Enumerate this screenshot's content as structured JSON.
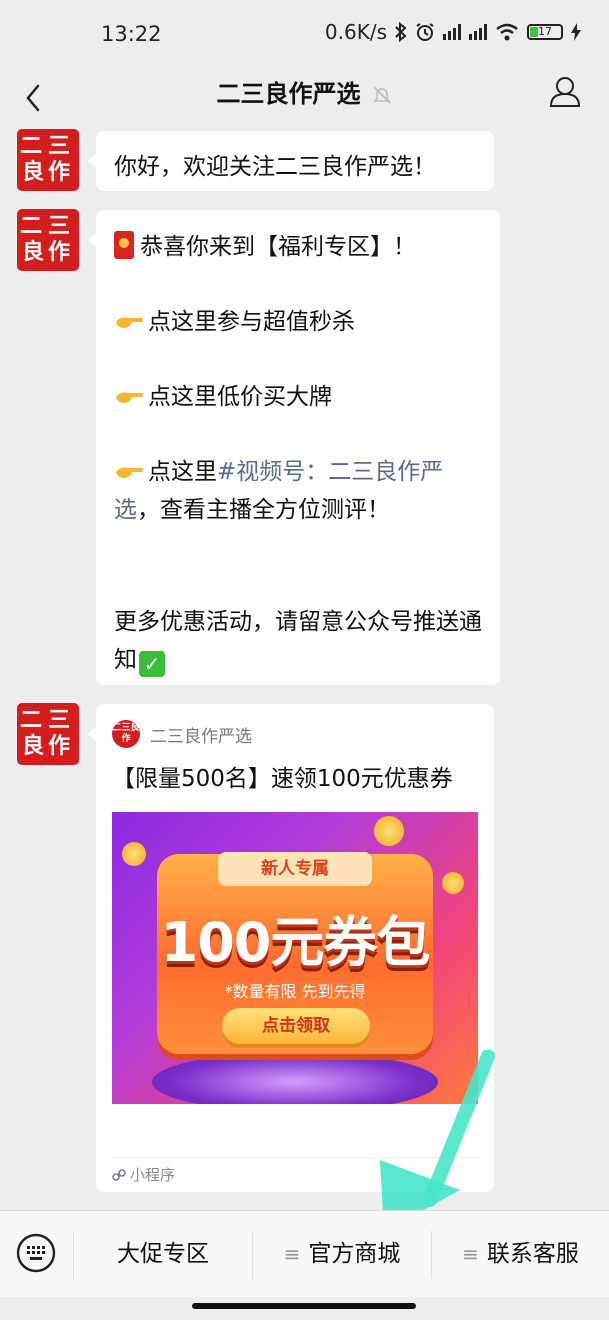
{
  "status_bar": {
    "time": "13:22",
    "net_speed": "0.6K/s",
    "battery_level": "17"
  },
  "nav": {
    "title": "二三良作严选"
  },
  "avatar": {
    "line1": "二三",
    "line2": "良作"
  },
  "messages": {
    "greeting": "你好，欢迎关注二三良作严选！",
    "welfare": {
      "line1": "恭喜你来到【福利专区】！",
      "line2": "点这里参与超值秒杀",
      "line3": "点这里低价买大牌",
      "line4_prefix": "点这里",
      "line4_link": "#视频号：二三良作严选",
      "line4_suffix": "，查看主播全方位测评！",
      "line5": "更多优惠活动，请留意公众号推送通知"
    },
    "mini_program": {
      "account_name": "二三良作严选",
      "logo_text": "二三良作",
      "title": "【限量500名】速领100元优惠券",
      "image": {
        "tag": "新人专属",
        "headline": "100元券包",
        "subtext": "*数量有限 先到先得",
        "button": "点击领取"
      },
      "footer": "小程序"
    }
  },
  "menu": {
    "items": [
      {
        "label": "大促专区"
      },
      {
        "label": "官方商城"
      },
      {
        "label": "联系客服"
      }
    ]
  }
}
